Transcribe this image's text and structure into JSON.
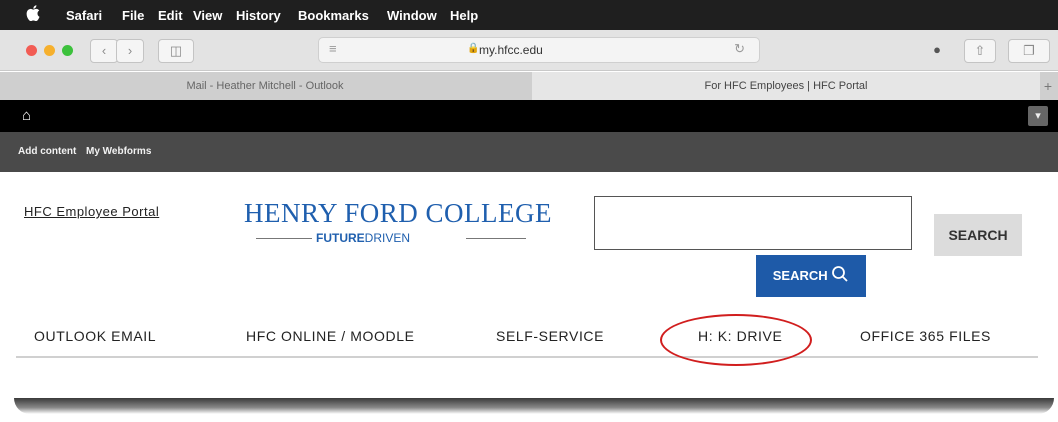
{
  "menubar": {
    "apple_icon": "",
    "items": [
      "Safari",
      "File",
      "Edit",
      "View",
      "History",
      "Bookmarks",
      "Window",
      "Help"
    ]
  },
  "toolbar": {
    "back": "‹",
    "forward": "›",
    "sidebar": "◫",
    "address_url": "my.hfcc.edu",
    "right_icons": [
      "info-icon",
      "share-icon",
      "tabs-icon"
    ]
  },
  "tabs": [
    {
      "label": "Mail - Heather Mitchell - Outlook",
      "active": false
    },
    {
      "label": "For HFC Employees | HFC Portal",
      "active": true
    }
  ],
  "adminbar": {
    "home_icon": "⌂",
    "toggle": "▾"
  },
  "subbar": {
    "items": [
      "Add content",
      "My Webforms"
    ]
  },
  "header": {
    "portal_link": "HFC Employee Portal",
    "logo_title": "HENRY FORD COLLEGE",
    "tagline_bold": "FUTURE",
    "tagline_rest": "DRIVEN",
    "search_button": "SEARCH",
    "search_button_blue": "SEARCH",
    "search_input_value": ""
  },
  "nav": {
    "items": [
      "OUTLOOK EMAIL",
      "HFC ONLINE / MOODLE",
      "SELF-SERVICE",
      "H: K: DRIVE",
      "OFFICE 365 FILES"
    ]
  },
  "colors": {
    "brand_blue": "#1e5aa8",
    "annotation_red": "#d11e1e"
  }
}
